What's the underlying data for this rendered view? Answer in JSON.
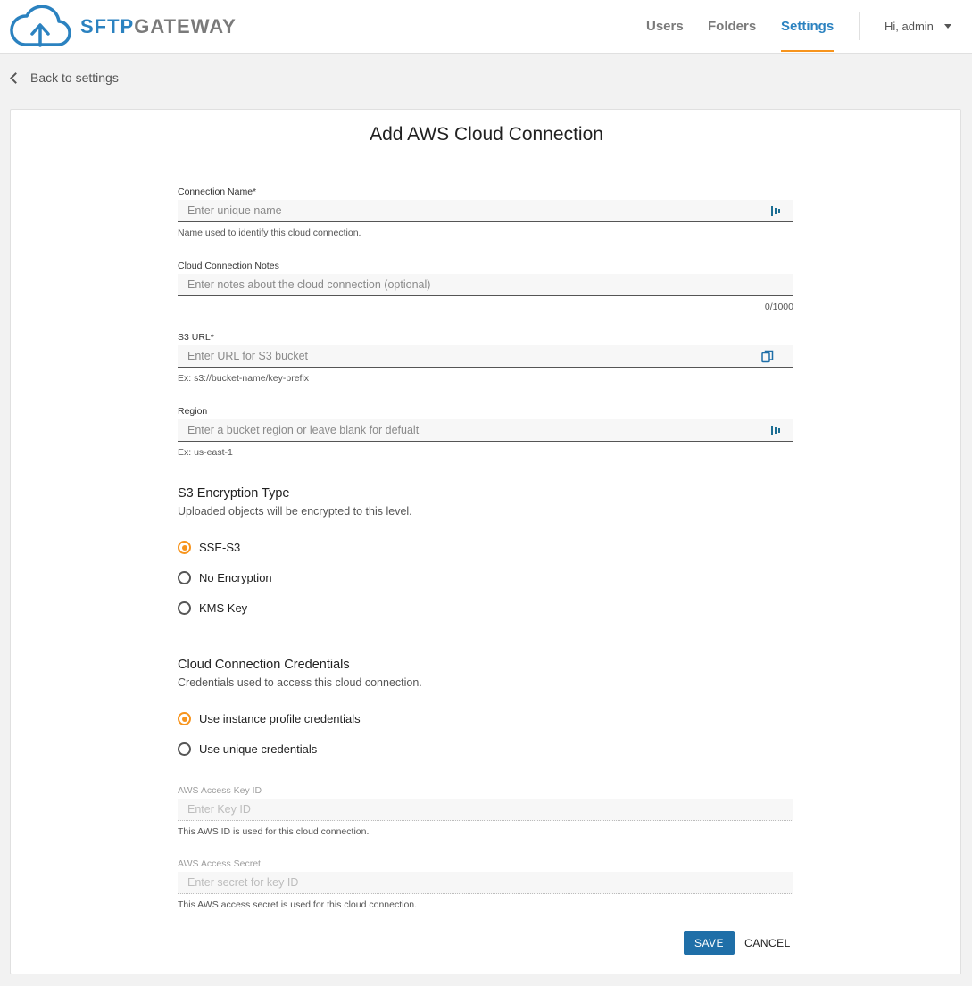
{
  "brand": {
    "part1": "SFTP",
    "part2": "GATEWAY",
    "accent": "#2b82c0",
    "secondary": "#f7941d"
  },
  "nav": {
    "users": "Users",
    "folders": "Folders",
    "settings": "Settings"
  },
  "user_menu": {
    "label": "Hi, admin",
    "icon": "chevron-down-icon"
  },
  "back_link": "Back to settings",
  "form": {
    "title": "Add AWS Cloud Connection",
    "connection_name": {
      "label": "Connection Name",
      "required_mark": "*",
      "placeholder": "Enter unique name",
      "value": "",
      "hint": "Name used to identify this cloud connection."
    },
    "notes": {
      "label": "Cloud Connection Notes",
      "placeholder": "Enter notes about the cloud connection (optional)",
      "value": "",
      "counter": "0/1000"
    },
    "s3_url": {
      "label": "S3 URL",
      "required_mark": "*",
      "placeholder": "Enter URL for S3 bucket",
      "value": "",
      "hint": "Ex: s3://bucket-name/key-prefix"
    },
    "region": {
      "label": "Region",
      "placeholder": "Enter a bucket region or leave blank for defualt",
      "value": "",
      "hint": "Ex: us-east-1"
    },
    "encryption": {
      "title": "S3 Encryption Type",
      "subtitle": "Uploaded objects will be encrypted to this level.",
      "options": [
        "SSE-S3",
        "No Encryption",
        "KMS Key"
      ],
      "selected": "SSE-S3"
    },
    "credentials": {
      "title": "Cloud Connection Credentials",
      "subtitle": "Credentials used to access this cloud connection.",
      "options": [
        "Use instance profile credentials",
        "Use unique credentials"
      ],
      "selected": "Use instance profile credentials"
    },
    "access_key_id": {
      "label": "AWS Access Key ID",
      "placeholder": "Enter Key ID",
      "value": "",
      "hint": "This AWS ID is used for this cloud connection."
    },
    "access_secret": {
      "label": "AWS Access Secret",
      "placeholder": "Enter secret for key ID",
      "value": "",
      "hint": "This AWS access secret is used for this cloud connection."
    },
    "save_label": "SAVE",
    "cancel_label": "CANCEL"
  }
}
